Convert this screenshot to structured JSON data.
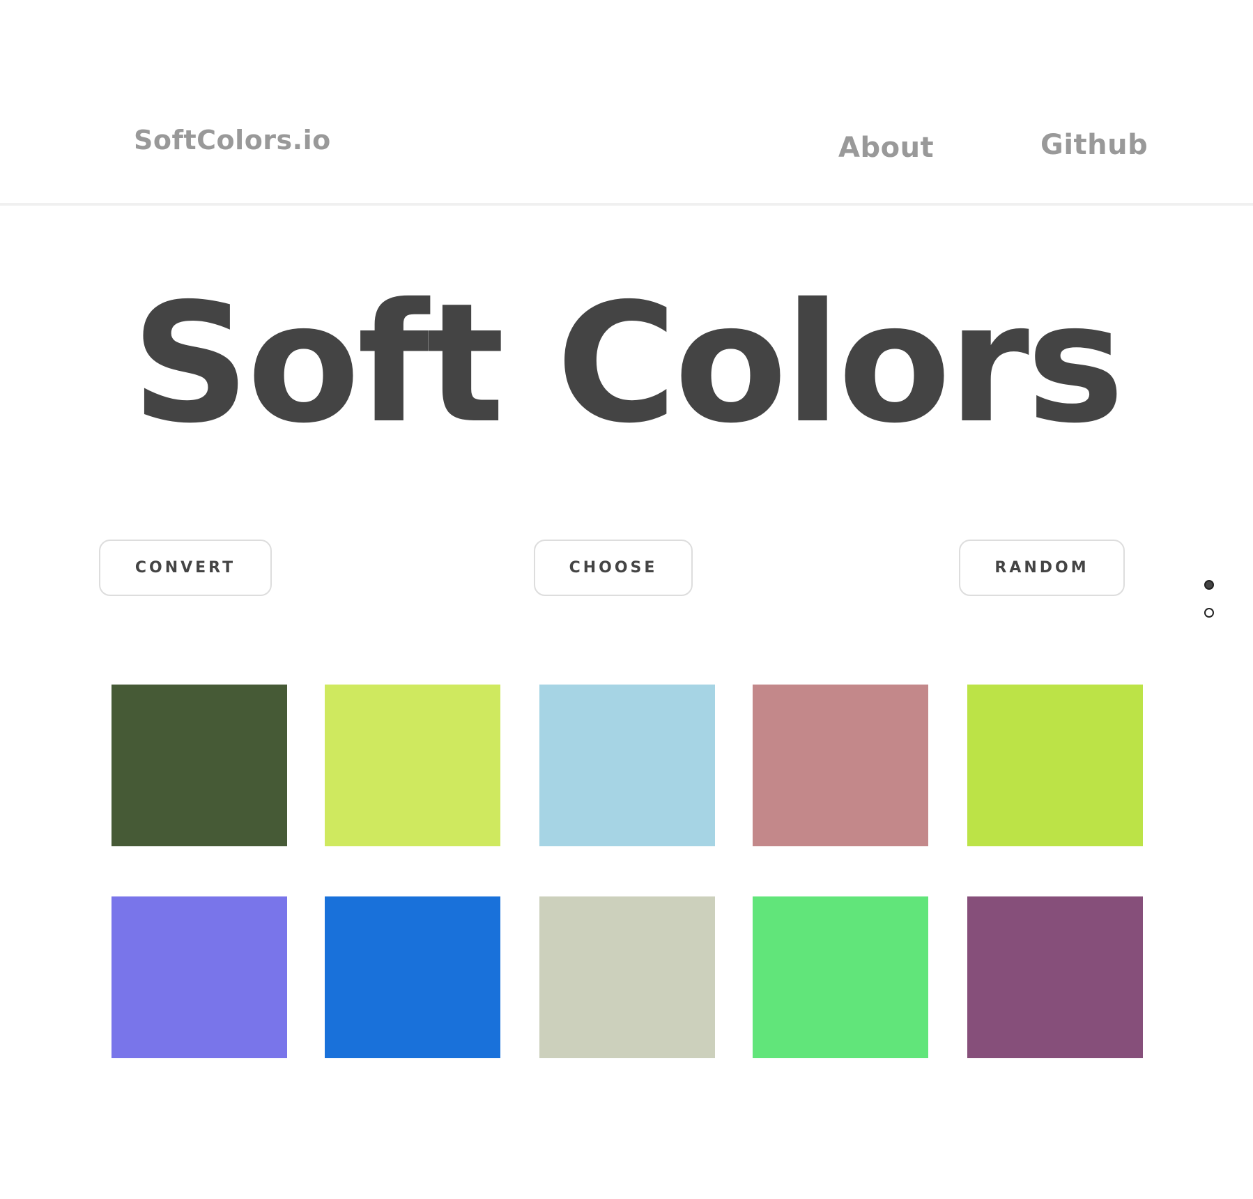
{
  "header": {
    "brand": "SoftColors.io",
    "nav": [
      {
        "label": "About"
      },
      {
        "label": "Github"
      }
    ]
  },
  "hero": {
    "title": "Soft Colors"
  },
  "actions": [
    {
      "label": "CONVERT"
    },
    {
      "label": "CHOOSE"
    },
    {
      "label": "RANDOM"
    }
  ],
  "pagination": {
    "current": 1,
    "total": 2
  },
  "swatches": [
    "#465A36",
    "#CFE95F",
    "#A6D4E4",
    "#C3888A",
    "#BCE347",
    "#7975EA",
    "#1971DA",
    "#CCD0BC",
    "#61E57A",
    "#864F7A"
  ]
}
